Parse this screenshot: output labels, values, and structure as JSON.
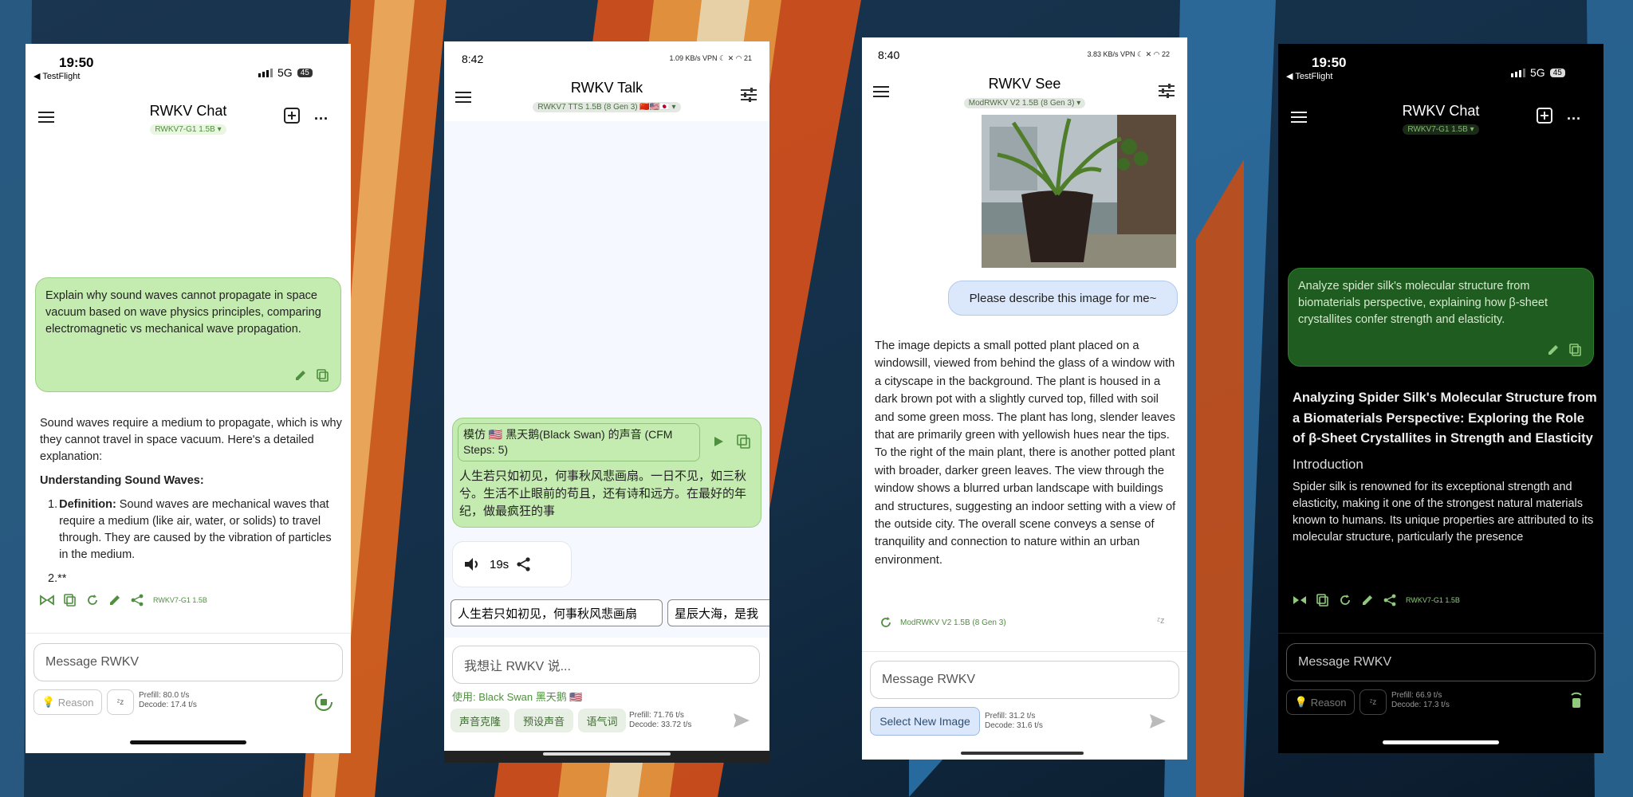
{
  "colors": {
    "accent_green": "#4f8f3f",
    "user_bubble": "#c5ecb0",
    "user_bubble_dark": "#1f5c1f",
    "see_bubble": "#dbe8fb"
  },
  "p1": {
    "time": "19:50",
    "back_label": "◀ TestFlight",
    "network": "5G",
    "battery": "45",
    "title": "RWKV Chat",
    "model": "RWKV7-G1 1.5B",
    "user_message": "Explain why sound waves cannot propagate in space vacuum based on wave physics principles, comparing electromagnetic vs mechanical wave propagation.",
    "reply_intro": "Sound waves require a medium to propagate, which is why they cannot travel in space vacuum. Here's a detailed explanation:",
    "reply_heading": "Understanding Sound Waves:",
    "reply_item1_num": "1.",
    "reply_item1_bold": "Definition:",
    "reply_item1_text": " Sound waves are mechanical waves that require a medium (like air, water, or solids) to travel through. They are caused by the vibration of particles in the medium.",
    "reply_item2": "2.**",
    "action_model": "RWKV7-G1 1.5B",
    "input_placeholder": "Message RWKV",
    "reason_label": "Reason",
    "prefill": "Prefill: 80.0 t/s",
    "decode": "Decode: 17.4 t/s"
  },
  "p2": {
    "time": "8:42",
    "status_icons": "1.09 KB/s  VPN  ☾  ✕  ◠  21",
    "title": "RWKV Talk",
    "model": "RWKV7 TTS 1.5B (8 Gen 3) 🇨🇳🇺🇸🇯🇵",
    "voice_tag": "模仿 🇺🇸 黑天鹅(Black Swan) 的声音 (CFM Steps: 5)",
    "user_text": "人生若只如初见，何事秋风悲画扇。一日不见，如三秋兮。生活不止眼前的苟且，还有诗和远方。在最好的年纪，做最疯狂的事",
    "audio_duration": "19s",
    "suggestion1": "人生若只如初见，何事秋风悲画扇",
    "suggestion2": "星辰大海，是我",
    "input_placeholder": "我想让 RWKV 说...",
    "using_label": "使用: Black Swan 黑天鹅 🇺🇸",
    "btn_clone": "声音克隆",
    "btn_preset": "预设声音",
    "btn_tone": "语气词",
    "prefill": "Prefill: 71.76 t/s",
    "decode": "Decode: 33.72 t/s"
  },
  "p3": {
    "time": "8:40",
    "status_icons": "3.83 KB/s  VPN  ☾  ✕  ◠  22",
    "title": "RWKV See",
    "model": "ModRWKV V2 1.5B (8 Gen 3)",
    "user_message": "Please describe this image for me~",
    "reply": "The image depicts a small potted plant placed on a windowsill, viewed from behind the glass of a window with a cityscape in the background. The plant is housed in a dark brown pot with a slightly curved top, filled with soil and some green moss. The plant has long, slender leaves that are primarily green with yellowish hues near the tips. To the right of the main plant, there is another potted plant with broader, darker green leaves. The view through the window shows a blurred urban landscape with buildings and structures, suggesting an indoor setting with a view of the outside city. The overall scene conveys a sense of tranquility and connection to nature within an urban environment.",
    "action_model": "ModRWKV V2 1.5B (8 Gen 3)",
    "input_placeholder": "Message RWKV",
    "select_image": "Select New Image",
    "prefill": "Prefill: 31.2 t/s",
    "decode": "Decode: 31.6 t/s"
  },
  "p4": {
    "time": "19:50",
    "back_label": "◀ TestFlight",
    "network": "5G",
    "battery": "45",
    "title": "RWKV Chat",
    "model": "RWKV7-G1 1.5B",
    "user_message": "Analyze spider silk's molecular structure from biomaterials perspective, explaining how β-sheet crystallites confer strength and elasticity.",
    "reply_heading": "Analyzing Spider Silk's Molecular Structure from a Biomaterials Perspective: Exploring the Role of β-Sheet Crystallites in Strength and Elasticity",
    "reply_subheading": "Introduction",
    "reply_body": "Spider silk is renowned for its exceptional strength and elasticity, making it one of the strongest natural materials known to humans. Its unique properties are attributed to its molecular structure, particularly the presence",
    "action_model": "RWKV7-G1 1.5B",
    "input_placeholder": "Message RWKV",
    "reason_label": "Reason",
    "prefill": "Prefill: 66.9 t/s",
    "decode": "Decode: 17.3 t/s"
  }
}
